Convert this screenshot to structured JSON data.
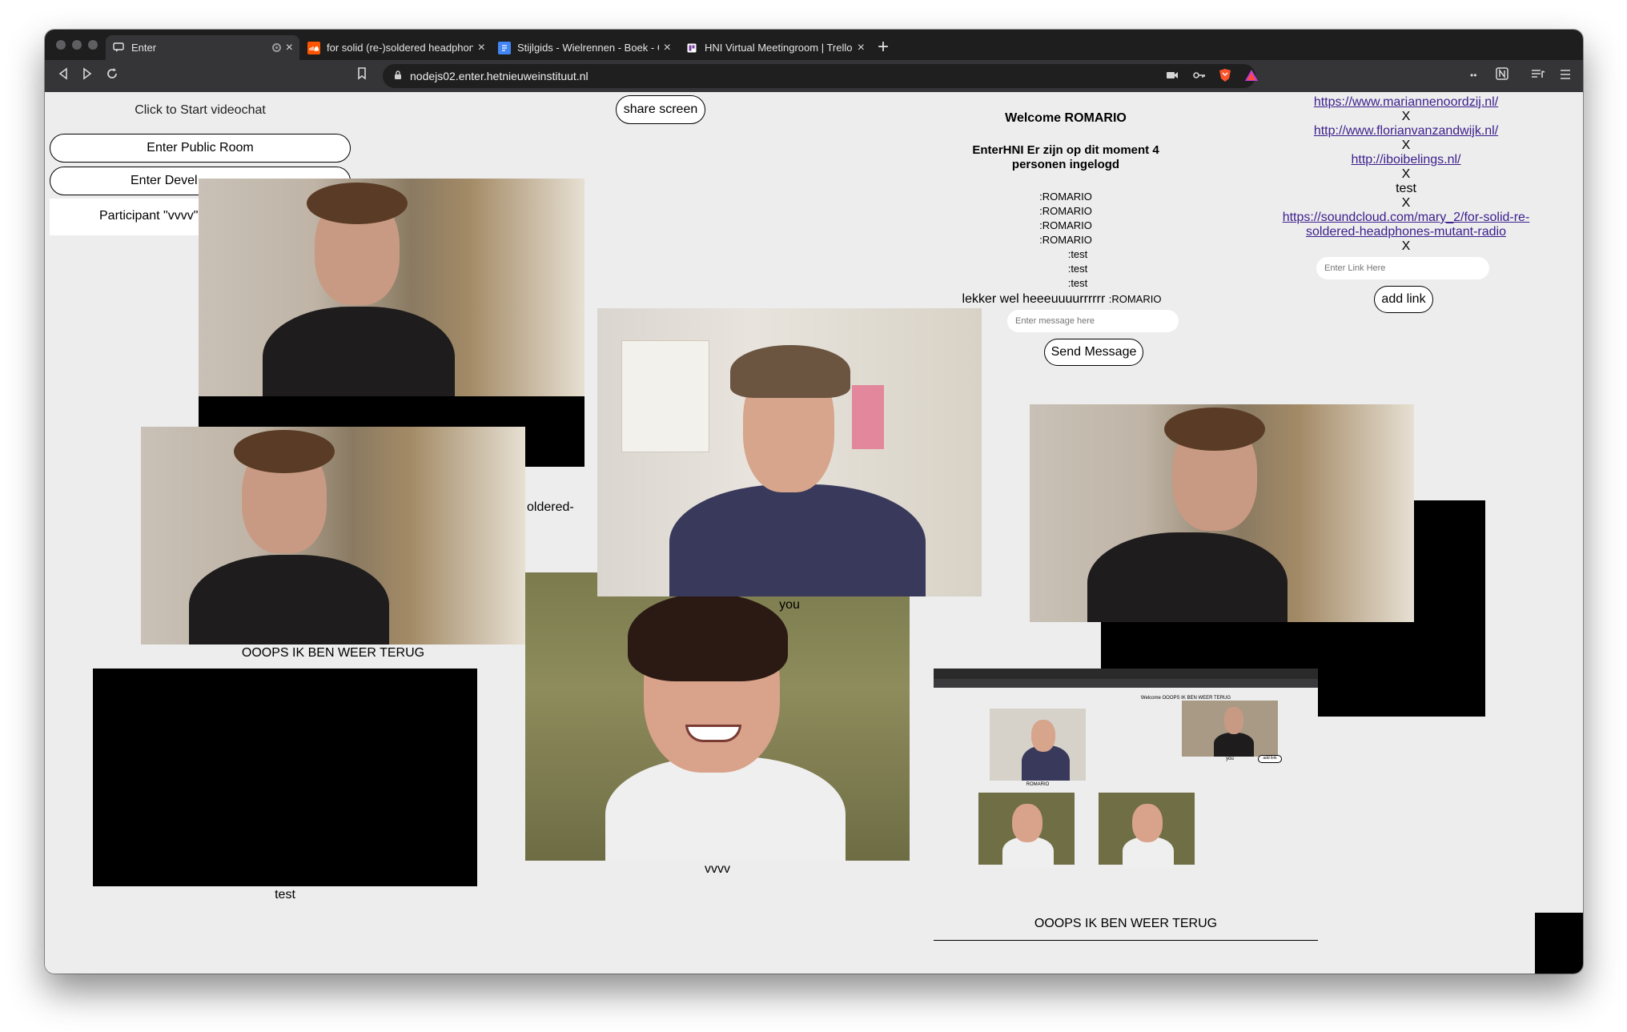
{
  "browser": {
    "tabs": [
      {
        "label": "Enter",
        "icon": "chat-icon",
        "active": true
      },
      {
        "label": "for solid (re-)soldered headphon",
        "icon": "soundcloud-icon",
        "color": "#ff5500"
      },
      {
        "label": "Stijlgids - Wielrennen - Boek - G",
        "icon": "docs-icon",
        "color": "#4285f4"
      },
      {
        "label": "HNI Virtual Meetingroom | Trello",
        "icon": "trello-icon",
        "color": "#ffffff"
      }
    ],
    "url": "nodejs02.enter.hetnieuweinstituut.nl"
  },
  "left_panel": {
    "start_label": "Click to Start videochat",
    "public_room_button": "Enter Public Room",
    "developer_room_button": "Enter Devel",
    "participant_text": "Participant \"vvvv\""
  },
  "share_screen_button": "share screen",
  "chat": {
    "welcome": "Welcome ROMARIO",
    "status": "EnterHNI Er zijn op dit moment 4 personen ingelogd",
    "users": [
      ":ROMARIO",
      ":ROMARIO",
      ":ROMARIO",
      ":ROMARIO",
      ":test",
      ":test",
      ":test"
    ],
    "last_message": "lekker wel heeeuuuurrrrrr",
    "last_message_author": ":ROMARIO",
    "input_placeholder": "Enter message here",
    "send_button": "Send Message"
  },
  "links": {
    "items": [
      "https://www.mariannenoordzij.nl/",
      "http://www.florianvanzandwijk.nl/",
      "http://iboibelings.nl/",
      "test",
      "https://soundcloud.com/mary_2/for-solid-re-soldered-headphones-mutant-radio"
    ],
    "remove_label": "X",
    "input_placeholder": "Enter Link Here",
    "add_button": "add link"
  },
  "video_labels": {
    "ooops1": "OOOPS IK BEN WEER TERUG",
    "test": "test",
    "you": "you",
    "vvvv": "vvvv",
    "ooops2": "OOOPS IK BEN WEER TERUG",
    "partial": "oldered-"
  },
  "screen_share_mini": {
    "welcome": "Welcome OOOPS IK BEN WEER TERUG",
    "label": "ROMARIO",
    "you": "you",
    "addlink": "add link"
  },
  "colors": {
    "page_background": "#ededed",
    "link": "#3b1e8c"
  }
}
